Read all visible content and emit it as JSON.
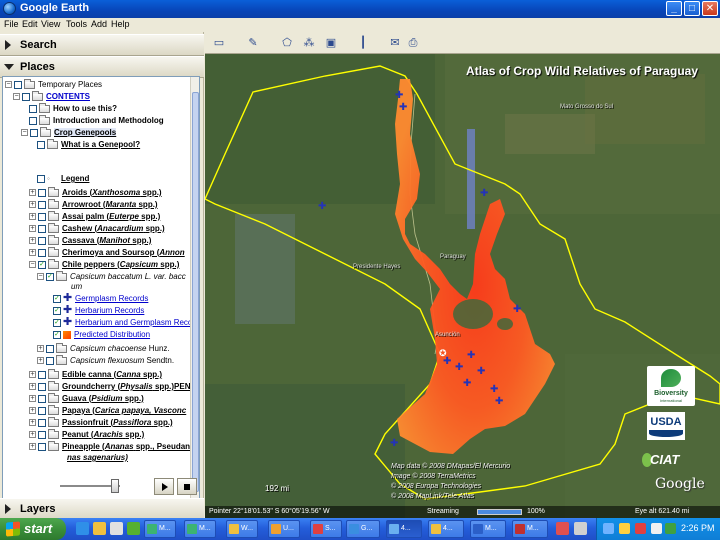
{
  "window": {
    "title": "Google Earth",
    "minimize": "_",
    "maximize": "□",
    "close": "✕"
  },
  "menu": [
    "File",
    "Edit",
    "View",
    "Tools",
    "Add",
    "Help"
  ],
  "panes": {
    "search": "Search",
    "places": "Places",
    "layers": "Layers"
  },
  "tree": {
    "temporary_places": "Temporary Places",
    "contents": "CONTENTS",
    "how_to_use": "How to use this?",
    "introduction": "Introduction and Methodolog",
    "crop_genepools": "Crop Genepools",
    "what_is_genepool": "What is a Genepool?",
    "legend": "Legend",
    "crops": [
      {
        "name": "Aroids",
        "sci": "Xanthosoma",
        "suffix": "spp.)"
      },
      {
        "name": "Arrowroot",
        "sci": "Maranta",
        "suffix": "spp.)"
      },
      {
        "name": "Assai palm",
        "sci": "Euterpe",
        "suffix": "spp.)"
      },
      {
        "name": "Cashew",
        "sci": "Anacardium",
        "suffix": "spp.)"
      },
      {
        "name": "Cassava",
        "sci": "Manihot",
        "suffix": "spp.)"
      },
      {
        "name": "Cherimoya and Soursop",
        "sci": "Annon",
        "suffix": ""
      },
      {
        "name": "Chile peppers",
        "sci": "Capsicum",
        "suffix": "spp.)"
      }
    ],
    "capsicum_baccatum_line1": "Capsicum baccatum L. var. bacc",
    "capsicum_baccatum_line2": "um",
    "germplasm": "Germplasm Records",
    "herbarium": "Herbarium Records",
    "herb_germ": "Herbarium and Germplasm Reco",
    "predicted": "Predicted Distribution",
    "chacoense": "Capsicum chacoense",
    "chacoense_auth": "Hunz.",
    "flexuosum": "Capsicum flexuosum",
    "flexuosum_auth": "Sendtn.",
    "crops2": [
      {
        "name": "Edible canna",
        "sci": "Canna",
        "suffix": "spp.)"
      },
      {
        "name": "Groundcherry",
        "sci": "Physalis",
        "suffix": "spp.)PEN"
      },
      {
        "name": "Guava",
        "sci": "Psidium",
        "suffix": "spp.)"
      },
      {
        "name": "Papaya",
        "sci": "Carica papaya, Vasconc",
        "suffix": ""
      },
      {
        "name": "Passionfruit",
        "sci": "Passiflora",
        "suffix": "spp.)"
      },
      {
        "name": "Peanut",
        "sci": "Arachis",
        "suffix": "spp.)"
      },
      {
        "name": "Pineapple",
        "sci": "Ananas",
        "suffix": "spp., Pseudan"
      }
    ],
    "pineapple_line2": "nas sagenarius)"
  },
  "map": {
    "title": "Atlas of Crop Wild Relatives of Paraguay",
    "labels": {
      "mato_grosso": "Mato Grosso do Sul",
      "paraguay": "Paraguay",
      "presidente_hayes": "Presidente Hayes",
      "asuncion": "Asunción"
    },
    "credits": [
      "Map data © 2008 DMapas/El Mercurio",
      "Image © 2008 TerraMetrics",
      "© 2008 Europa Technologies",
      "© 2008 MapLink/Tele Atlas"
    ],
    "scale": "192 mi",
    "pointer": "Pointer  22°18'01.53\" S     60°05'19.56\" W",
    "streaming": "Streaming",
    "streaming_pct": "100%",
    "streaming_fraction": 1.0,
    "eye_alt": "Eye alt    621.40 mi",
    "logos": {
      "bioversity": "Bioversity",
      "bioversity_sub": "International",
      "usda": "USDA",
      "ciat": "CIAT",
      "google": "Google"
    }
  },
  "taskbar": {
    "start": "start",
    "tasks": [
      "M...",
      "M...",
      "W...",
      "U...",
      "S...",
      "G...",
      "4...",
      "4...",
      "M...",
      "M..."
    ],
    "clock": "2:26 PM"
  }
}
